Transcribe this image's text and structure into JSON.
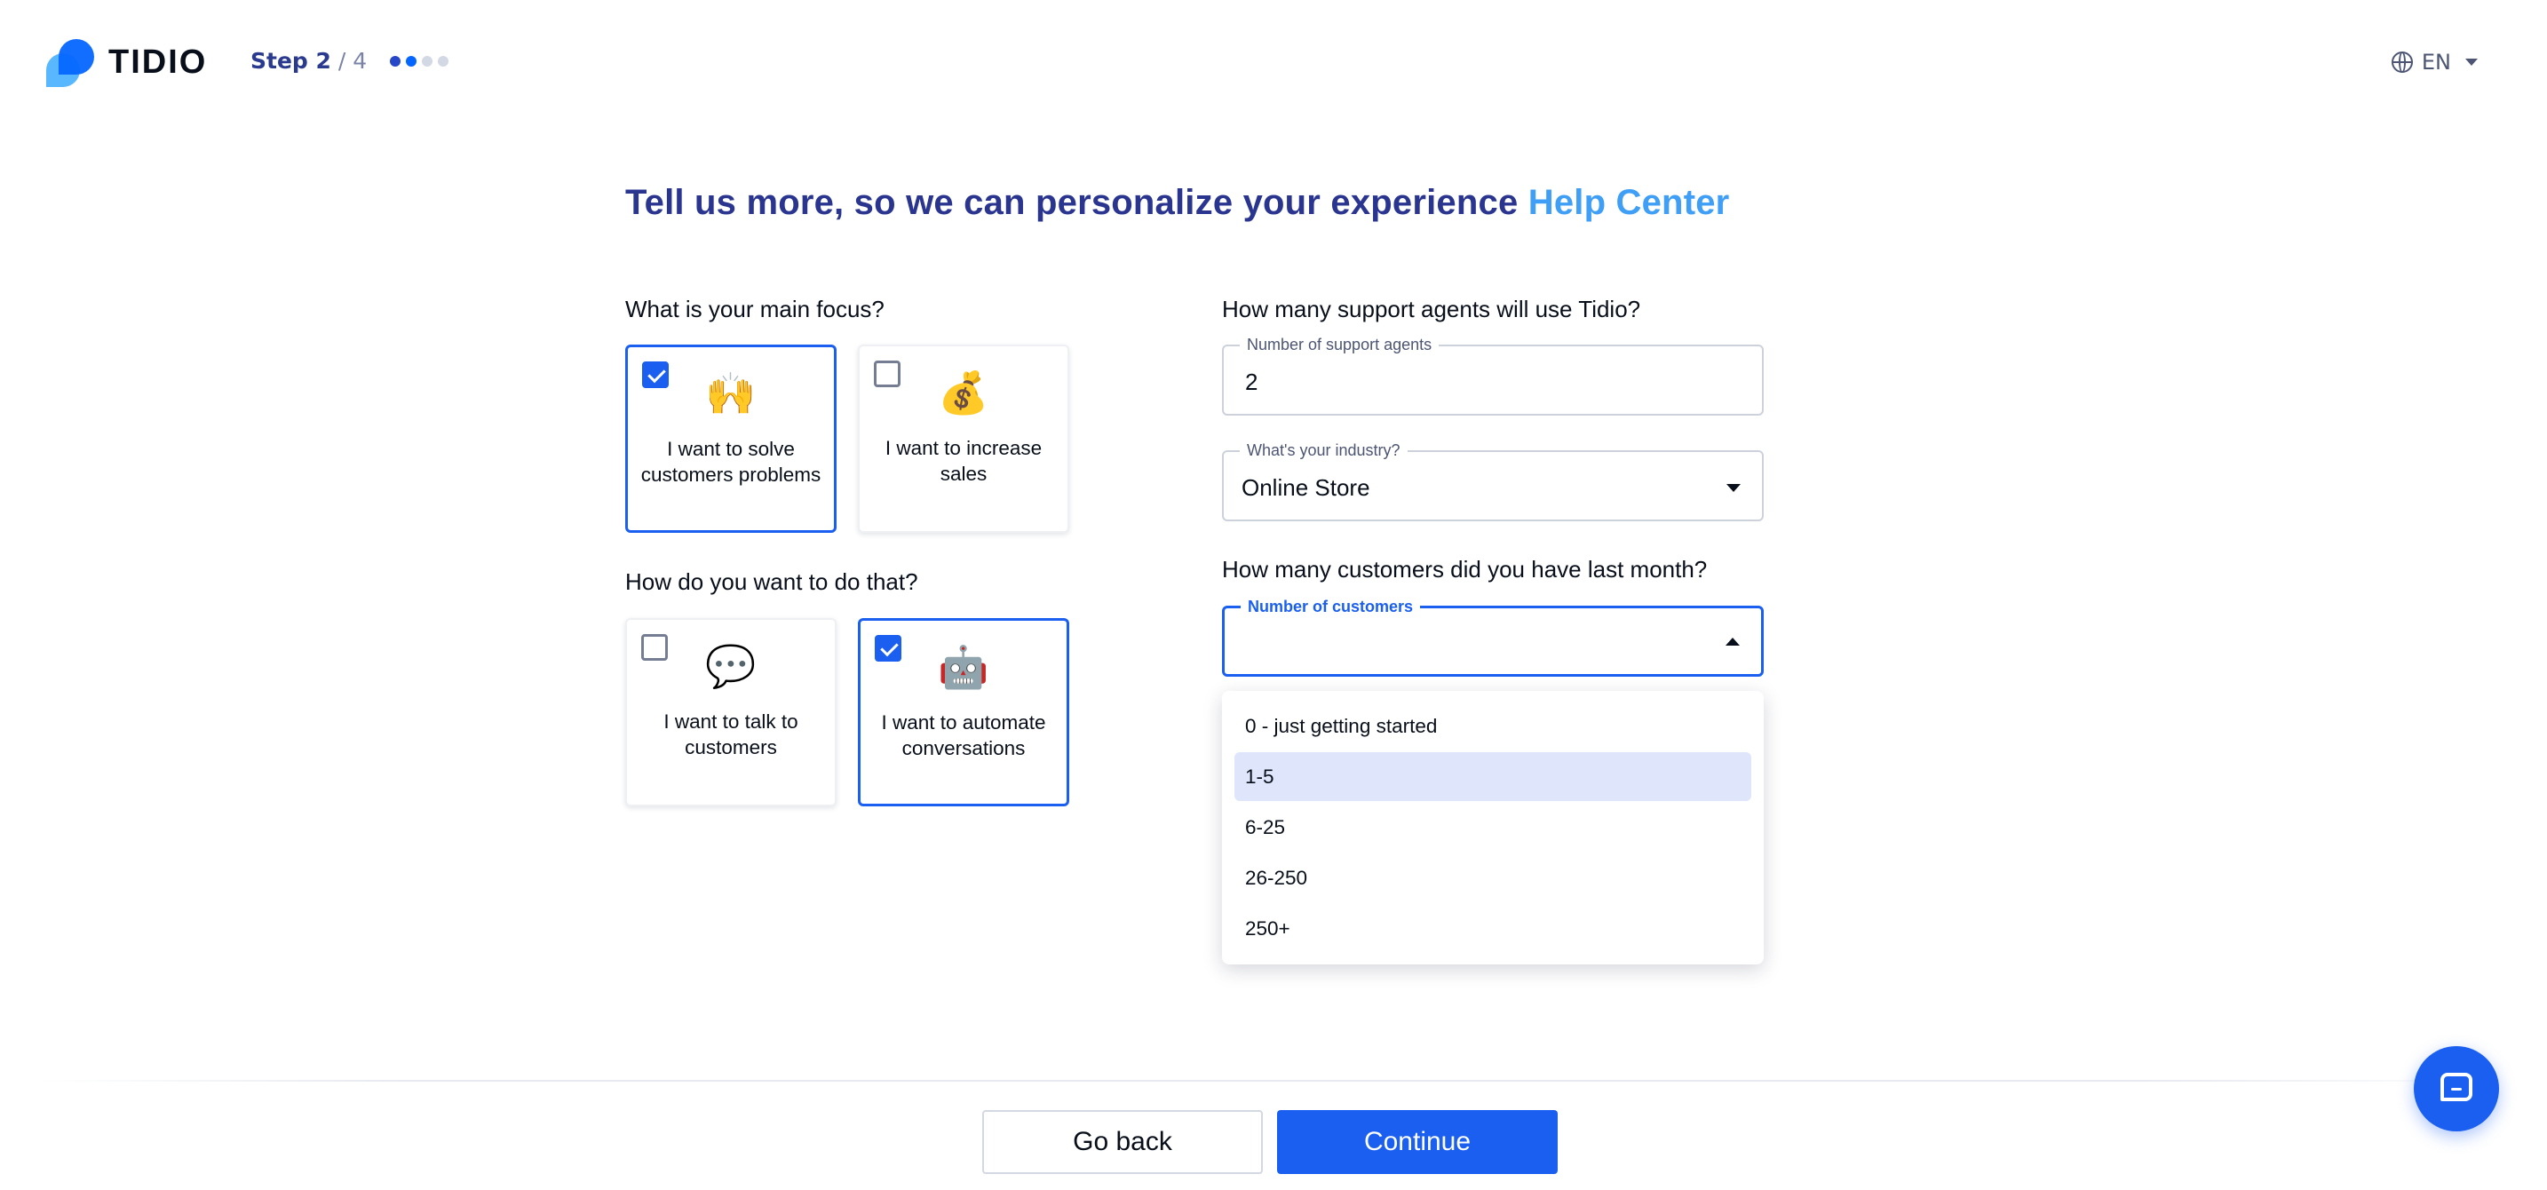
{
  "header": {
    "logo_text": "TIDIO",
    "step_label": "Step 2",
    "step_total": "/ 4",
    "language": "EN"
  },
  "title": {
    "main": "Tell us more, so we can personalize your experience",
    "highlight": "Help Center"
  },
  "focus": {
    "question": "What is your main focus?",
    "options": [
      {
        "label": "I want to solve customers problems",
        "emoji": "🙌",
        "icon": "raising-hands-icon",
        "checked": true
      },
      {
        "label": "I want to increase sales",
        "emoji": "💰",
        "icon": "money-bag-icon",
        "checked": false
      }
    ]
  },
  "method": {
    "question": "How do you want to do that?",
    "options": [
      {
        "label": "I want to talk to customers",
        "emoji": "💬",
        "icon": "speech-bubble-icon",
        "checked": false
      },
      {
        "label": "I want to automate conversations",
        "emoji": "🤖",
        "icon": "robot-icon",
        "checked": true
      }
    ]
  },
  "agents": {
    "question": "How many support agents will use Tidio?",
    "label": "Number of support agents",
    "value": "2"
  },
  "industry": {
    "label": "What's your industry?",
    "value": "Online Store"
  },
  "customers": {
    "question": "How many customers did you have last month?",
    "label": "Number of customers",
    "value": "",
    "options": [
      "0 - just getting started",
      "1-5",
      "6-25",
      "26-250",
      "250+"
    ],
    "highlighted": "1-5"
  },
  "footer": {
    "back_label": "Go back",
    "continue_label": "Continue"
  },
  "colors": {
    "accent": "#1a5ff0",
    "title": "#2a3590",
    "highlight": "#3f9ef5"
  }
}
